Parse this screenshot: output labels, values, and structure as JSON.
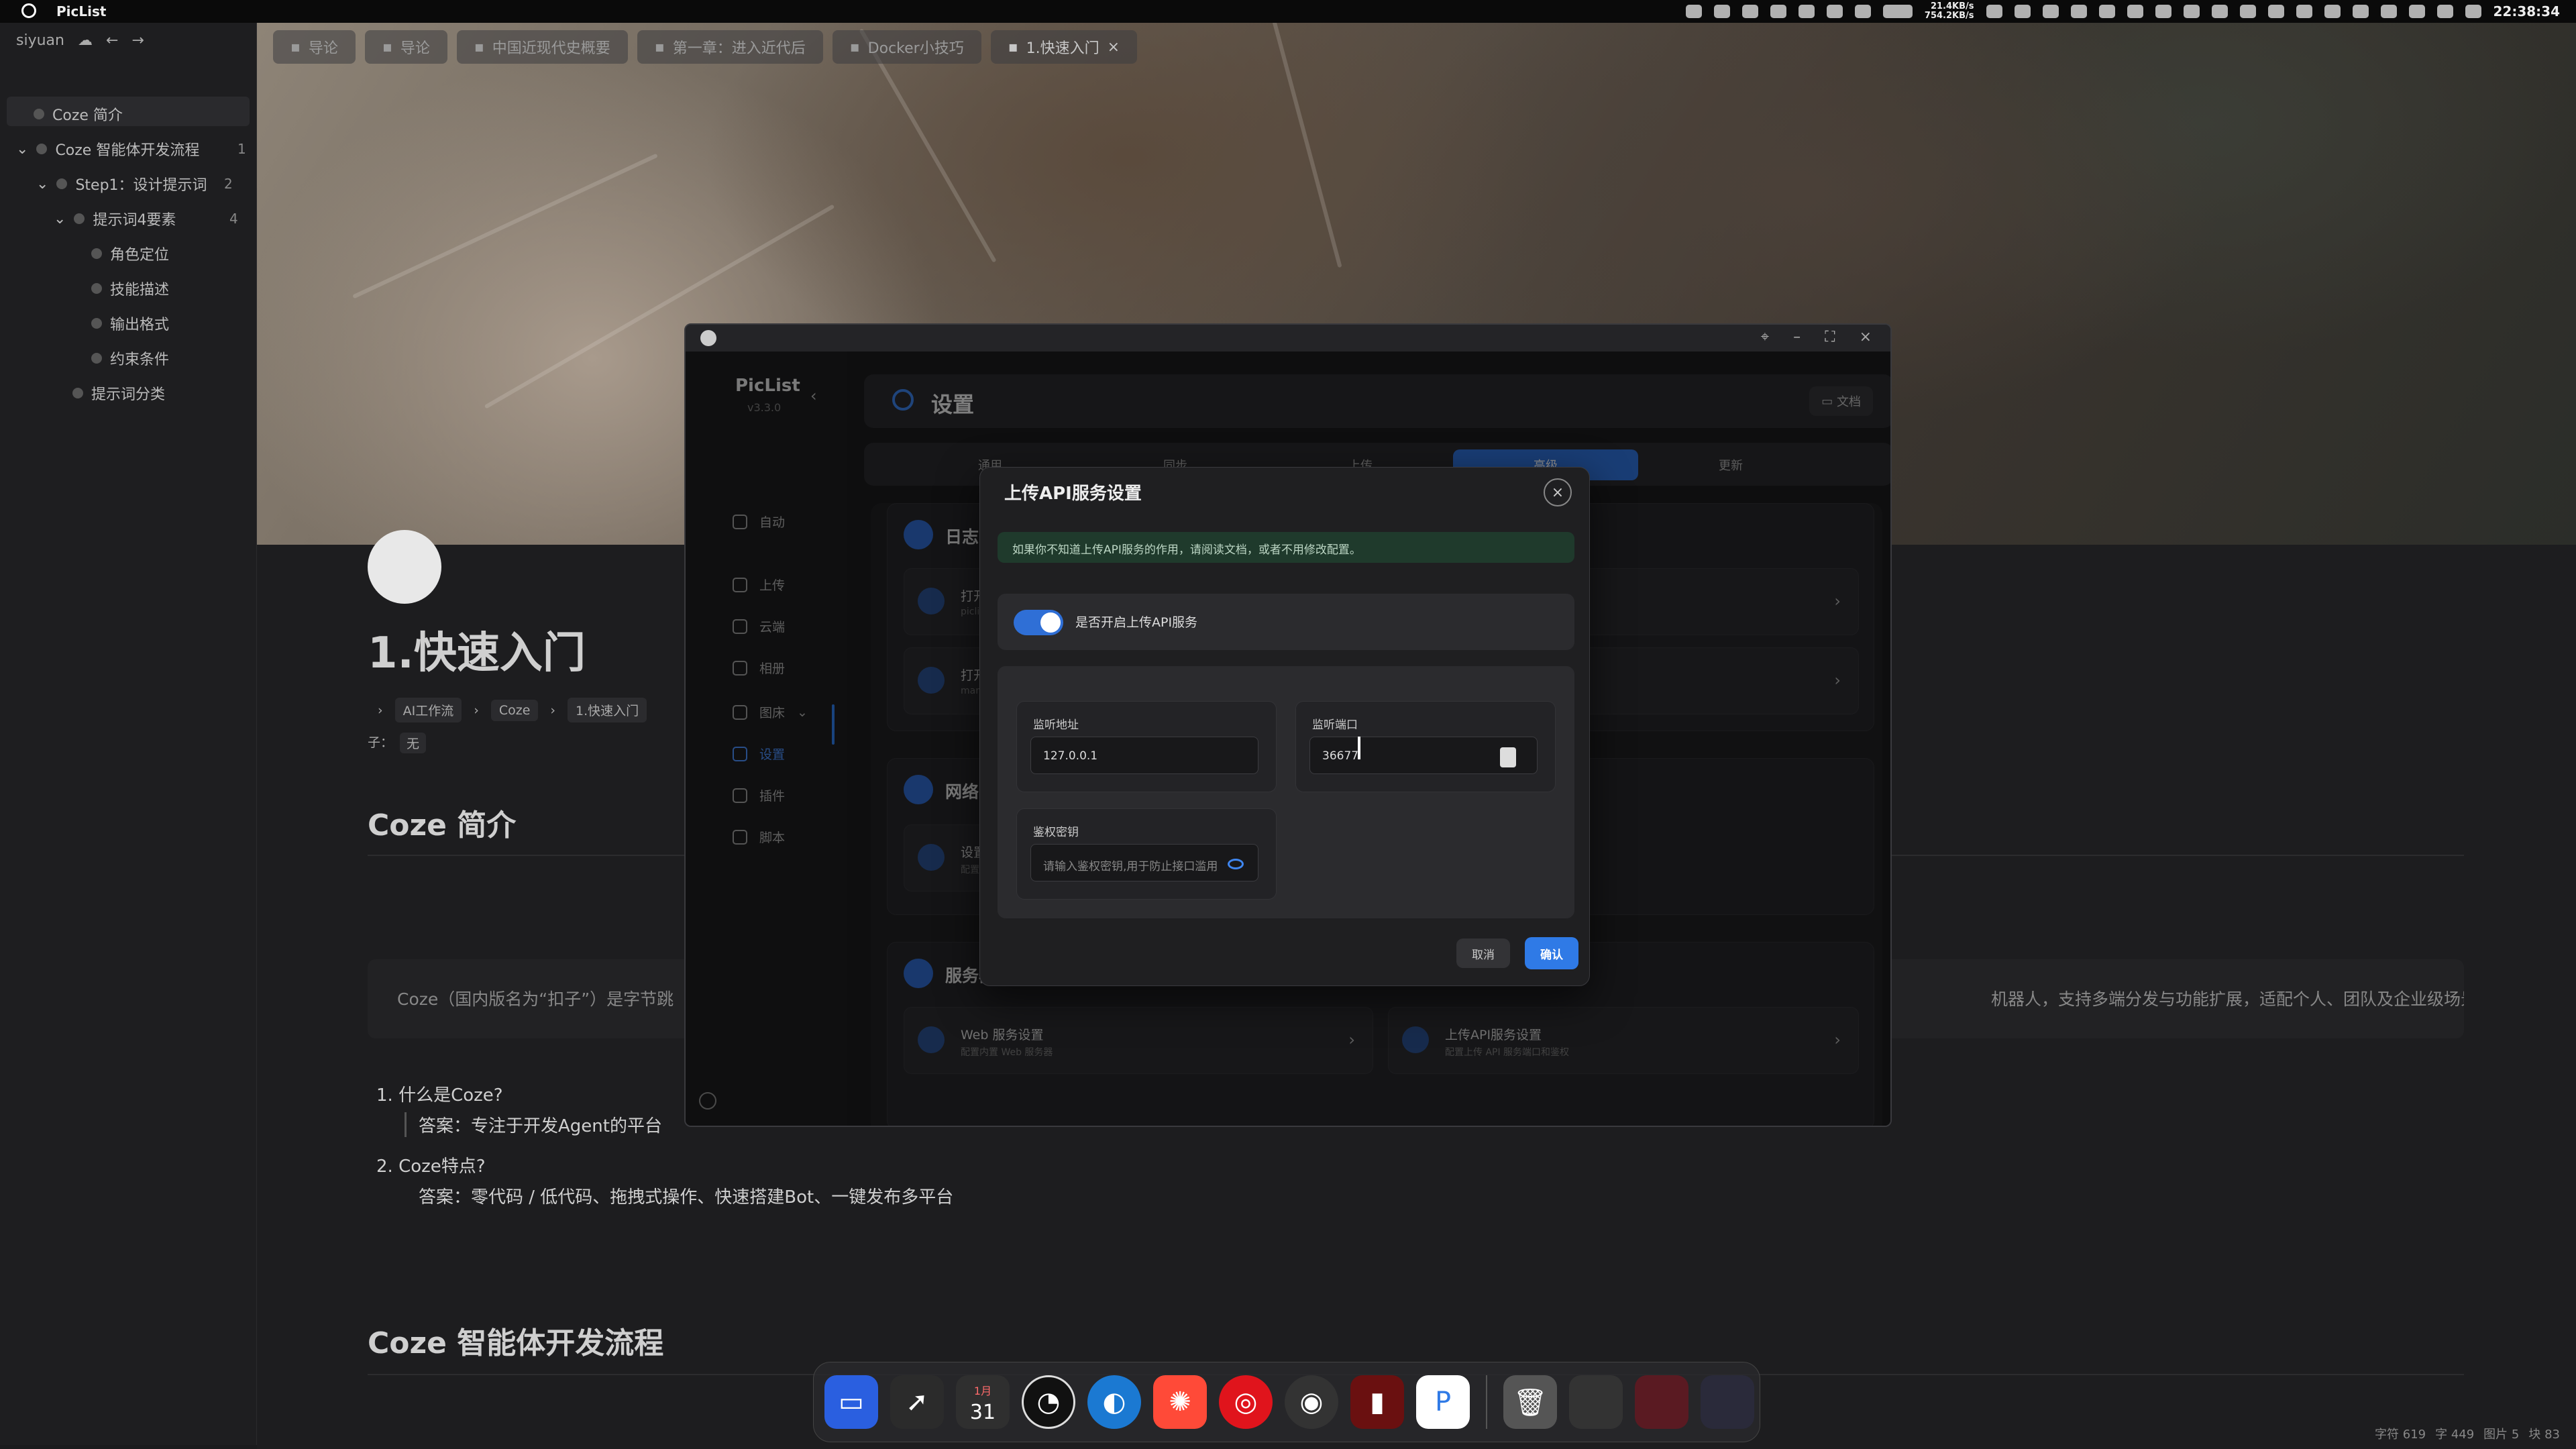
{
  "menubar": {
    "app_name": "PicList",
    "net_up": "21.4KB/s",
    "net_down": "754.2KB/s",
    "clock": "22:38:34"
  },
  "siyuan": {
    "workspace": "siyuan",
    "outline": [
      {
        "label": "Coze 简介",
        "count": ""
      },
      {
        "label": "Coze 智能体开发流程",
        "count": "1"
      },
      {
        "label": "Step1：设计提示词",
        "count": "2"
      },
      {
        "label": "提示词4要素",
        "count": "4"
      },
      {
        "label": "角色定位",
        "count": ""
      },
      {
        "label": "技能描述",
        "count": ""
      },
      {
        "label": "输出格式",
        "count": ""
      },
      {
        "label": "约束条件",
        "count": ""
      },
      {
        "label": "提示词分类",
        "count": ""
      }
    ],
    "tabs": [
      "导论",
      "导论",
      "中国近现代史概要",
      "第一章：进入近代后",
      "Docker小技巧",
      "1.快速入门"
    ],
    "doc": {
      "title": "1.快速入门",
      "breadcrumbs": [
        "AI工作流",
        "Coze",
        "1.快速入门"
      ],
      "tag_label": "子：",
      "tag_value": "无",
      "h2_intro": "Coze 简介",
      "para": "Coze（国内版名为“扣子”）是字节跳",
      "para_tail": "机器人，支持多端分发与功能扩展，适配个人、团队及企业级场景。",
      "list": [
        {
          "num": "1.",
          "q": "什么是Coze?",
          "a": "答案：专注于开发Agent的平台"
        },
        {
          "num": "2.",
          "q": "Coze特点?",
          "a": "答案：零代码 / 低代码、拖拽式操作、快速搭建Bot、一键发布多平台"
        }
      ],
      "h2_flow": "Coze 智能体开发流程"
    },
    "status": [
      "字符 619",
      "字 449",
      "图片 5",
      "块 83"
    ]
  },
  "piclist": {
    "brand": "PicList",
    "version": "v3.3.0",
    "nav": [
      "自动",
      "上传",
      "云端",
      "相册",
      "图床",
      "设置",
      "插件",
      "脚本"
    ],
    "header_title": "设置",
    "doc_button": "文档",
    "tabs": [
      "通用",
      "同步",
      "上传",
      "高级",
      "更新"
    ],
    "sections": {
      "log": {
        "title": "日志",
        "items": [
          {
            "title": "打开常规",
            "sub": "piclist.log"
          },
          {
            "title": "打开云端",
            "sub": "manage"
          }
        ]
      },
      "network": {
        "title": "网络与代",
        "items": [
          {
            "title": "设置代理",
            "sub": "配置网络"
          }
        ]
      },
      "server": {
        "title": "服务器设置",
        "items": [
          {
            "title": "Web 服务设置",
            "sub": "配置内置 Web 服务器"
          },
          {
            "title": "上传API服务设置",
            "sub": "配置上传 API 服务端口和鉴权"
          }
        ]
      }
    }
  },
  "modal": {
    "title": "上传API服务设置",
    "tip": "如果你不知道上传API服务的作用，请阅读文档，或者不用修改配置。",
    "toggle_label": "是否开启上传API服务",
    "toggle_on": true,
    "listen_address_label": "监听地址",
    "listen_address_value": "127.0.0.1",
    "listen_port_label": "监听端口",
    "listen_port_value": "36677",
    "secret_label": "鉴权密钥",
    "secret_placeholder": "请输入鉴权密钥,用于防止接口滥用",
    "cancel": "取消",
    "confirm": "确认"
  },
  "dock": {
    "calendar_month": "1月",
    "calendar_day": "31"
  },
  "colors": {
    "accent": "#2f7ae6",
    "tip_bg": "#1f3a2c"
  }
}
